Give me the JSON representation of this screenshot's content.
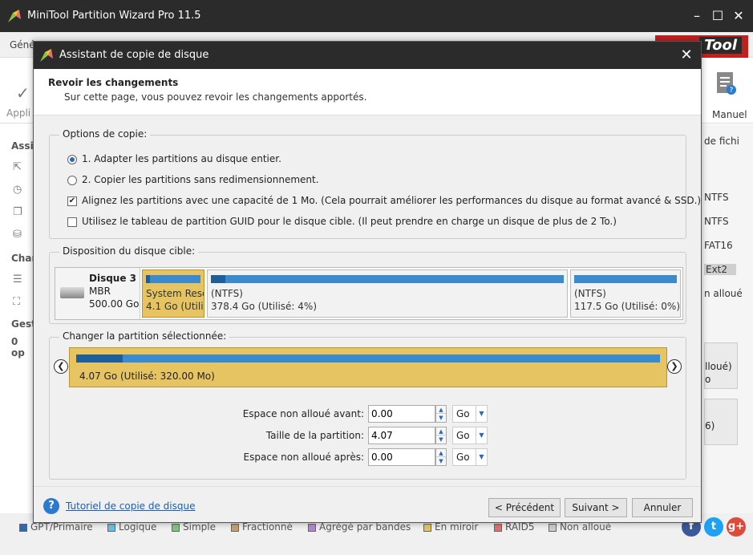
{
  "app": {
    "title": "MiniTool Partition Wizard Pro 11.5",
    "menu_first": "Géné",
    "brand": "Tool",
    "toolbar_left_label": "Appli",
    "manual_label": "Manuel"
  },
  "left_panel": {
    "section1": "Assi",
    "section2": "Chan",
    "section3": "Gest",
    "ops": "0 op"
  },
  "right_panel": {
    "header": "de fichi",
    "rows": [
      "NTFS",
      "NTFS",
      "FAT16",
      "Ext2",
      "n alloué"
    ],
    "box1_a": "lloué)",
    "box1_b": "o",
    "box2_a": "6)"
  },
  "legend": {
    "items": [
      "GPT/Primaire",
      "Logique",
      "Simple",
      "Fractionné",
      "Agrégé par bandes",
      "En miroir",
      "RAID5",
      "Non alloué"
    ],
    "colors": [
      "#2a6ab8",
      "#68c0e8",
      "#7fc87f",
      "#c8a070",
      "#b488d0",
      "#e6c462",
      "#e07070",
      "#cccccc"
    ]
  },
  "dialog": {
    "title": "Assistant de copie de disque",
    "header_title": "Revoir les changements",
    "header_sub": "Sur cette page, vous pouvez revoir les changements apportés.",
    "options_group": "Options de copie:",
    "opt1": "1. Adapter les partitions au disque entier.",
    "opt2": "2. Copier les partitions sans redimensionnement.",
    "chk1": "Alignez les partitions avec une capacité de 1 Mo. (Cela pourrait améliorer les performances du disque au format avancé & SSD.)",
    "chk2": "Utilisez le tableau de partition GUID pour le disque cible. (Il peut prendre en charge un disque de plus de 2 To.)",
    "opt1_selected": true,
    "chk1_checked": true,
    "chk2_checked": false,
    "layout_group": "Disposition du disque cible:",
    "disk": {
      "name": "Disque 3",
      "type": "MBR",
      "size": "500.00 Go"
    },
    "partitions": [
      {
        "label": "System Rese",
        "detail": "4.1 Go (Utili",
        "used_fraction": 0.08
      },
      {
        "label": "(NTFS)",
        "detail": "378.4 Go (Utilisé: 4%)",
        "used_fraction": 0.04
      },
      {
        "label": "(NTFS)",
        "detail": "117.5 Go (Utilisé: 0%)",
        "used_fraction": 0.0
      }
    ],
    "change_group": "Changer la partition sélectionnée:",
    "selected_detail": "4.07 Go (Utilisé: 320.00 Mo)",
    "selected_used_fraction": 0.08,
    "fields": [
      {
        "label": "Espace non alloué avant:",
        "value": "0.00",
        "unit": "Go"
      },
      {
        "label": "Taille de la partition:",
        "value": "4.07",
        "unit": "Go"
      },
      {
        "label": "Espace non alloué après:",
        "value": "0.00",
        "unit": "Go"
      }
    ],
    "help_link": "Tutoriel de copie de disque",
    "btn_prev": "< Précédent",
    "btn_next": "Suivant >",
    "btn_cancel": "Annuler"
  }
}
